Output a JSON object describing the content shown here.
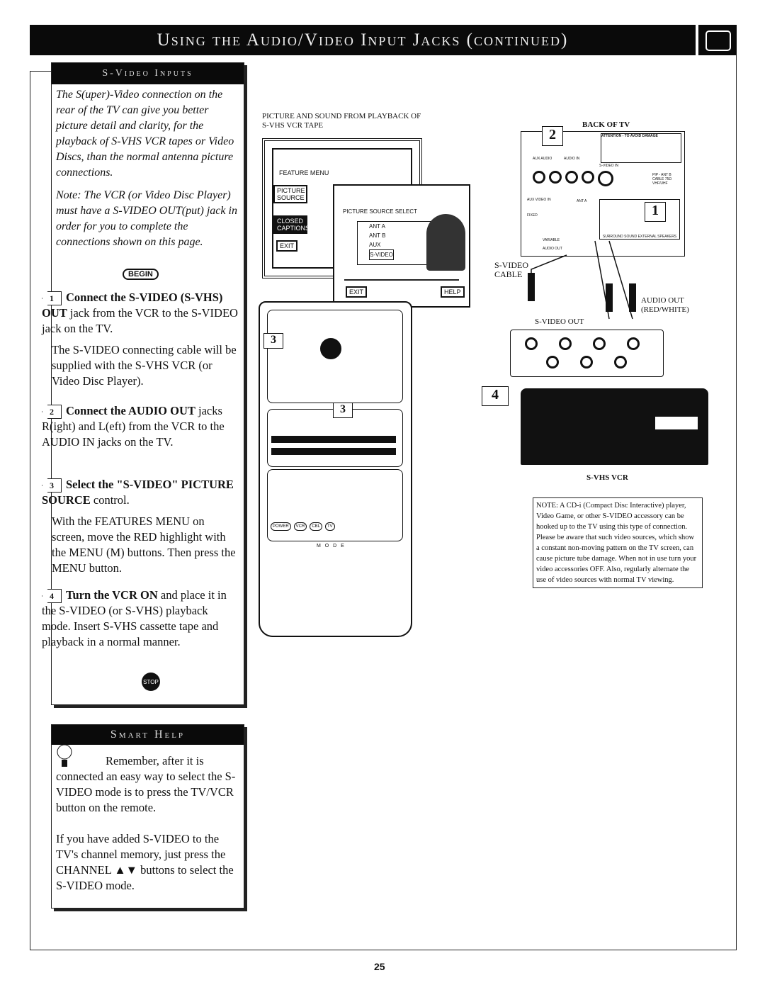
{
  "header": {
    "title": "Using the Audio/Video Input Jacks (continued)"
  },
  "svideo_panel": {
    "title": "S-Video Inputs",
    "intro": "The S(uper)-Video connection on the rear of the TV can give you better picture detail and clarity, for the playback of S-VHS VCR tapes or Video Discs, than the normal antenna picture connections.",
    "note": "Note: The VCR (or Video Disc Player) must have a S-VIDEO OUT(put) jack in order for you to complete the connections shown on this page.",
    "begin_label": "BEGIN",
    "steps": [
      {
        "number": "1",
        "heading": "Connect the S-VIDEO (S-VHS) OUT",
        "body": "jack from the VCR to the S-VIDEO jack on the TV.",
        "extra": "The S-VIDEO connecting cable will be supplied with the S-VHS VCR (or Video Disc Player)."
      },
      {
        "number": "2",
        "heading": "Connect the AUDIO OUT",
        "body": "jacks R(ight) and L(eft) from the VCR to the AUDIO IN jacks on the TV.",
        "extra": ""
      },
      {
        "number": "3",
        "heading": "Select the \"S-VIDEO\" PICTURE SOURCE",
        "body": "control.",
        "extra": "With the FEATURES MENU on screen, move the RED highlight with the MENU (M) buttons. Then press the MENU button."
      },
      {
        "number": "4",
        "heading": "Turn the VCR ON",
        "body": "and place it in the S-VIDEO (or S-VHS) playback mode. Insert S-VHS cassette tape and playback in a normal manner.",
        "extra": ""
      }
    ],
    "stop_label": "STOP"
  },
  "smart_help": {
    "title": "Smart Help",
    "para1": "Remember, after it is connected an easy way to select the S-VIDEO mode is to press the TV/VCR button on the remote.",
    "para2": "If you have added S-VIDEO to the TV's channel memory, just press the CHANNEL ▲▼ buttons to select the S-VIDEO mode."
  },
  "illustration": {
    "caption_tv": "PICTURE AND SOUND FROM PLAYBACK OF S-VHS VCR TAPE",
    "feature_menu": "FEATURE MENU",
    "menu_items": [
      "PICTURE SOURCE",
      "CLOSED CAPTIONS",
      "EXIT"
    ],
    "source_select": "PICTURE SOURCE SELECT",
    "source_options": [
      "ANT A",
      "ANT B",
      "AUX",
      "S-VIDEO"
    ],
    "selected_option": "S-VIDEO",
    "exit": "EXIT",
    "help": "HELP",
    "back_of_tv": "BACK OF TV",
    "attention": "ATTENTION - TO AVOID DAMAGE",
    "jack_labels": [
      "AUX AUDIO",
      "AUDIO IN",
      "S-VIDEO IN",
      "AUX VIDEO IN",
      "ANT A",
      "AUDIO OUT",
      "SURROUND SOUND EXTERNAL SPEAKERS",
      "PIP - ANT B CABLE 75Ω VHF/UHF",
      "FIXED",
      "VARIABLE"
    ],
    "svideo_cable": "S-VIDEO CABLE",
    "svideo_out": "S-VIDEO OUT",
    "audio_out": "AUDIO OUT (RED/WHITE)",
    "vcr_label": "S-VHS VCR",
    "callouts": [
      "1",
      "2",
      "3",
      "3",
      "4"
    ],
    "remote_mode": "M O D E",
    "remote_keys": [
      "POWER",
      "VCR",
      "CBL",
      "TV"
    ]
  },
  "note_box": "NOTE: A CD-i (Compact Disc Interactive) player, Video Game, or other S-VIDEO accessory can be hooked up to the TV using this type of connection. Please be aware that such video sources, which show a constant non-moving pattern on the TV screen, can cause picture tube damage. When not in use turn your video accessories OFF. Also, regularly alternate the use of video sources with normal TV viewing.",
  "page_number": "25"
}
